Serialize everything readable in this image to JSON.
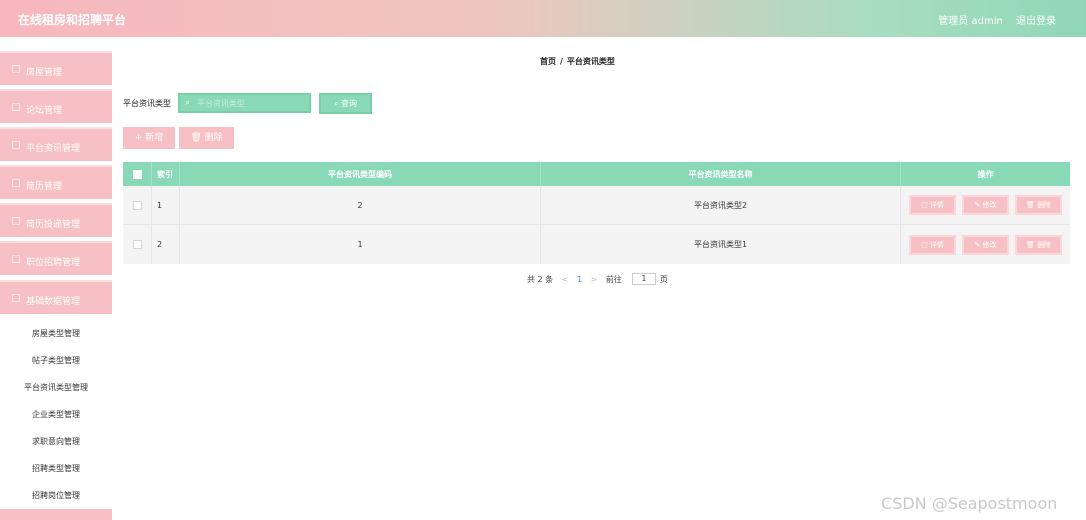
{
  "header": {
    "title": "在线租房和招聘平台",
    "user_label": "管理员 admin",
    "logout": "退出登录"
  },
  "sidebar": {
    "menus": [
      "房屋管理",
      "论坛管理",
      "平台资讯管理",
      "简历管理",
      "简历投递管理",
      "职位招聘管理",
      "基础数据管理"
    ],
    "sub_items": [
      "房屋类型管理",
      "帖子类型管理",
      "平台资讯类型管理",
      "企业类型管理",
      "求职意向管理",
      "招聘类型管理",
      "招聘岗位管理"
    ]
  },
  "breadcrumb": {
    "home": "首页",
    "sep": "/",
    "current": "平台资讯类型"
  },
  "search": {
    "label": "平台资讯类型",
    "placeholder": "平台资讯类型",
    "icon": "search-icon",
    "button": "查询"
  },
  "toolbar": {
    "add": "+ 新增",
    "delete": "删除"
  },
  "table": {
    "headers": [
      "索引",
      "平台资讯类型编码",
      "平台资讯类型名称",
      "操作"
    ],
    "rows": [
      {
        "index": "1",
        "code": "2",
        "name": "平台资讯类型2"
      },
      {
        "index": "2",
        "code": "1",
        "name": "平台资讯类型1"
      }
    ],
    "actions": {
      "detail": "详情",
      "edit": "修改",
      "delete": "删除"
    }
  },
  "pagination": {
    "total": "共 2 条",
    "prev": "<",
    "page": "1",
    "next": ">",
    "goto_label": "前往",
    "goto_value": "1",
    "page_unit": "页"
  },
  "watermark": "CSDN @Seapostmoon",
  "colors": {
    "accent_green": "#89d9b6",
    "accent_pink": "#f6c0c4"
  }
}
